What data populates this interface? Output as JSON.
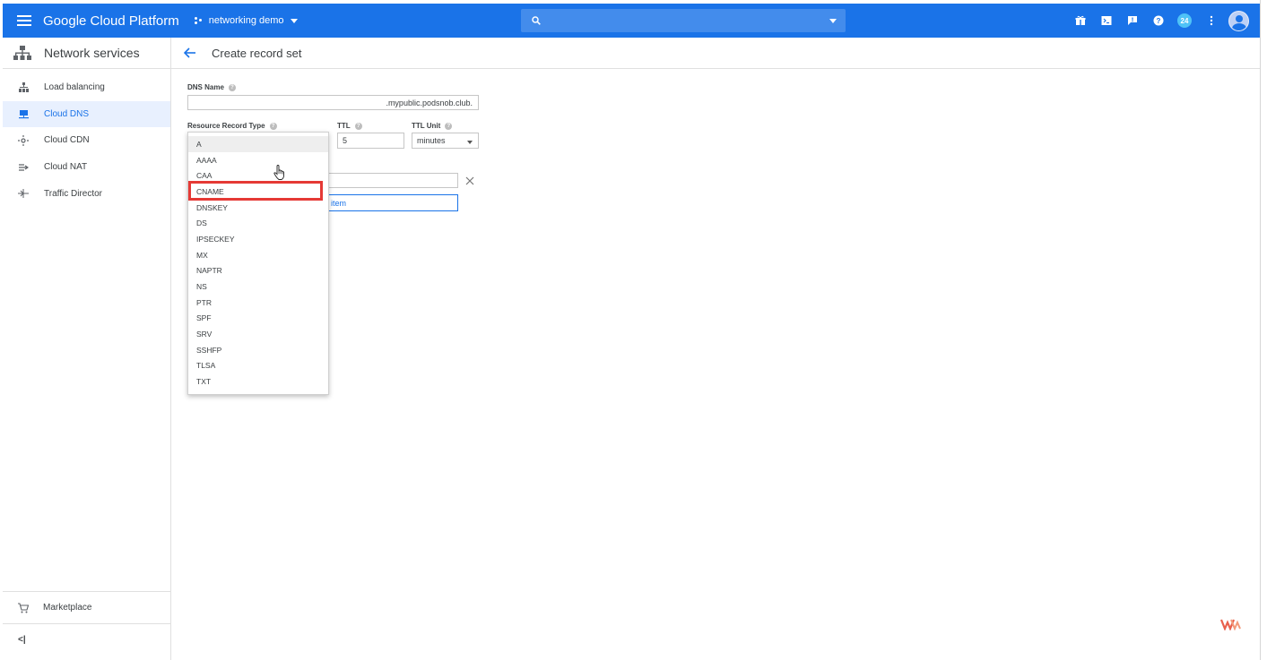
{
  "header": {
    "brand": "Google Cloud Platform",
    "project": "networking demo",
    "notification_count": "24",
    "color": "#1a73e8"
  },
  "sidebar": {
    "title": "Network services",
    "items": [
      {
        "label": "Load balancing",
        "icon": "load-balancing-icon",
        "active": false
      },
      {
        "label": "Cloud DNS",
        "icon": "cloud-dns-icon",
        "active": true
      },
      {
        "label": "Cloud CDN",
        "icon": "cloud-cdn-icon",
        "active": false
      },
      {
        "label": "Cloud NAT",
        "icon": "cloud-nat-icon",
        "active": false
      },
      {
        "label": "Traffic Director",
        "icon": "traffic-director-icon",
        "active": false
      }
    ],
    "marketplace": "Marketplace",
    "collapse": "<|"
  },
  "page": {
    "title": "Create record set"
  },
  "form": {
    "dns_name_label": "DNS Name",
    "dns_name_suffix": ".mypublic.podsnob.club.",
    "record_type_label": "Resource Record Type",
    "ttl_label": "TTL",
    "ttl_value": "5",
    "ttl_unit_label": "TTL Unit",
    "ttl_unit_value": "minutes",
    "add_item_label": "item"
  },
  "record_type_menu": {
    "options": [
      "A",
      "AAAA",
      "CAA",
      "CNAME",
      "DNSKEY",
      "DS",
      "IPSECKEY",
      "MX",
      "NAPTR",
      "NS",
      "PTR",
      "SPF",
      "SRV",
      "SSHFP",
      "TLSA",
      "TXT"
    ],
    "selected": "A",
    "highlighted": "CNAME",
    "highlight_color": "#e53935"
  }
}
